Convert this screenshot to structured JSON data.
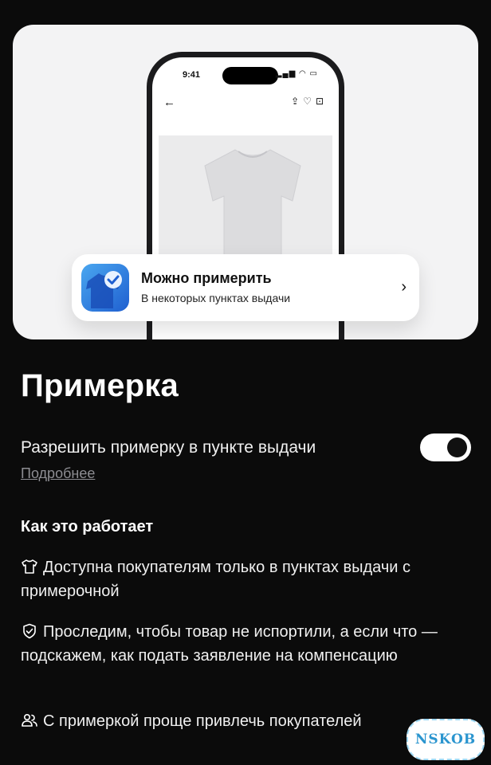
{
  "phone": {
    "time": "9:41"
  },
  "banner": {
    "title": "Можно примерить",
    "subtitle": "В некоторых пунктах выдачи"
  },
  "page": {
    "title": "Примерка"
  },
  "setting": {
    "label": "Разрешить примерку в пункте выдачи",
    "enabled": true,
    "more_link": "Подробнее"
  },
  "how_it_works": {
    "title": "Как это работает",
    "items": [
      {
        "icon": "tshirt-icon",
        "text": "Доступна покупателям только в пунктах выдачи с примерочной"
      },
      {
        "icon": "shield-check-icon",
        "text": "Проследим, чтобы товар не испортили, а если что — подскажем, как подать заявление на компенсацию"
      },
      {
        "icon": "users-icon",
        "text": "С примеркой проще привлечь покупателей"
      }
    ]
  },
  "watermark": "NSKOB"
}
